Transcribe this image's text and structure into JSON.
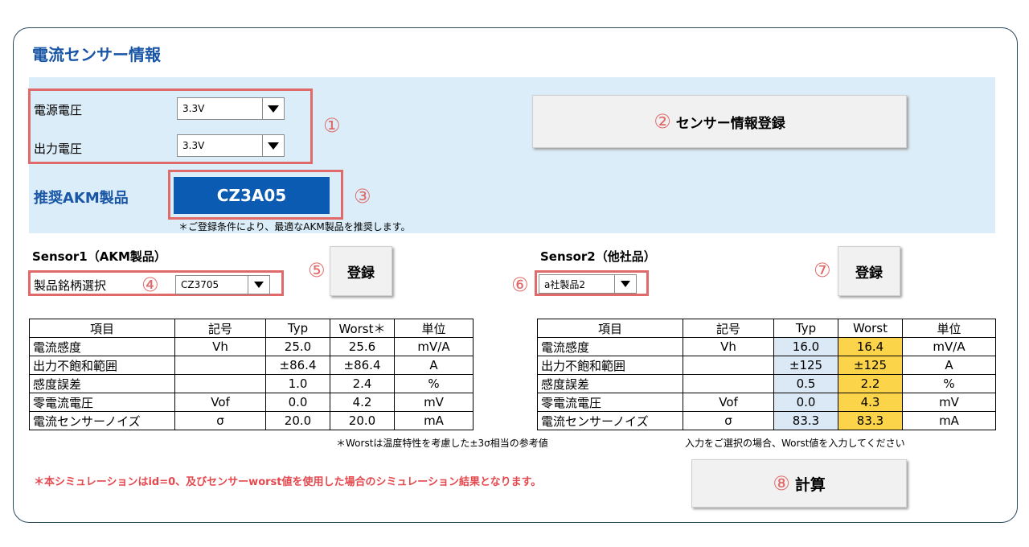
{
  "title": "電流センサー情報",
  "supply": {
    "label": "電源電圧",
    "value": "3.3V"
  },
  "output": {
    "label": "出力電圧",
    "value": "3.3V"
  },
  "markers": {
    "m1": "①",
    "m2": "②",
    "m3": "③",
    "m4": "④",
    "m5": "⑤",
    "m6": "⑥",
    "m7": "⑦",
    "m8": "⑧"
  },
  "register_sensor_label": "センサー情報登録",
  "recommended": {
    "label": "推奨AKM製品",
    "product": "CZ3A05",
    "note": "＊ご登録条件により、最適なAKM製品を推奨します。"
  },
  "sensor1": {
    "title": "Sensor1（AKM製品）",
    "select_label": "製品銘柄選択",
    "selected": "CZ3705",
    "register_label": "登録",
    "headers": [
      "項目",
      "記号",
      "Typ",
      "Worst＊",
      "単位"
    ],
    "rows": [
      [
        "電流感度",
        "Vh",
        "25.0",
        "25.6",
        "mV/A"
      ],
      [
        "出力不飽和範囲",
        "",
        "±86.4",
        "±86.4",
        "A"
      ],
      [
        "感度誤差",
        "",
        "1.0",
        "2.4",
        "%"
      ],
      [
        "零電流電圧",
        "Vof",
        "0.0",
        "4.2",
        "mV"
      ],
      [
        "電流センサーノイズ",
        "σ",
        "20.0",
        "20.0",
        "mA"
      ]
    ],
    "footnote": "＊Worstは温度特性を考慮した±3σ相当の参考値"
  },
  "sensor2": {
    "title": "Sensor2（他社品）",
    "selected": "a社製品2",
    "register_label": "登録",
    "headers": [
      "項目",
      "記号",
      "Typ",
      "Worst",
      "単位"
    ],
    "rows": [
      [
        "電流感度",
        "Vh",
        "16.0",
        "16.4",
        "mV/A"
      ],
      [
        "出力不飽和範囲",
        "",
        "±125",
        "±125",
        "A"
      ],
      [
        "感度誤差",
        "",
        "0.5",
        "2.2",
        "%"
      ],
      [
        "零電流電圧",
        "Vof",
        "0.0",
        "4.3",
        "mV"
      ],
      [
        "電流センサーノイズ",
        "σ",
        "83.3",
        "83.3",
        "mA"
      ]
    ],
    "footnote": "入力をご選択の場合、Worst値を入力してください"
  },
  "warning": "＊本シミュレーションはid=0、及びセンサーworst値を使用した場合のシミュレーション結果となります。",
  "calc_label": "計算",
  "colors": {
    "accent_blue": "#1a56a6",
    "product_bg": "#0b5bb3",
    "marker_red": "#e06a6a",
    "typ_highlight": "#dbe9f7",
    "worst_highlight": "#fbd44a",
    "band_bg": "#dbedf8"
  }
}
